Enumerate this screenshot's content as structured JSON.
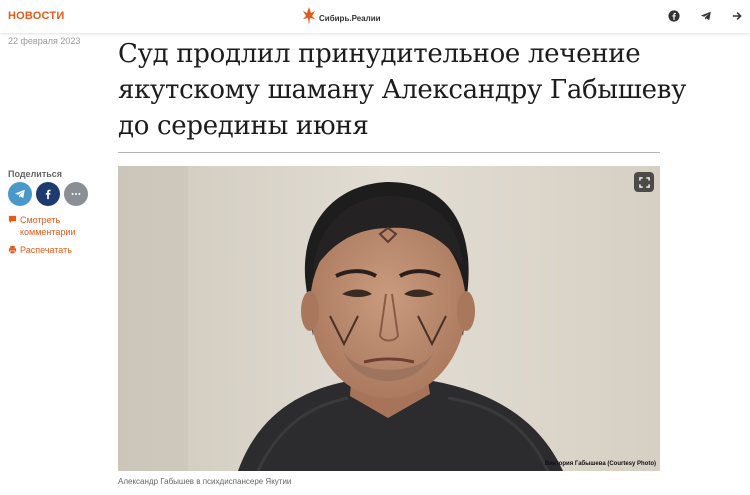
{
  "header": {
    "nav_label": "НОВОСТИ",
    "logo_text": "Сибирь.Реалии",
    "brand_color": "#e35a1c",
    "social_icons": [
      "facebook-icon",
      "telegram-icon",
      "share-icon"
    ]
  },
  "article": {
    "date": "22 февраля 2023",
    "title_lines": [
      "Суд продлил принудительное лечение",
      "якутскому шаману Александру Габышеву",
      "до середины июня"
    ]
  },
  "sidebar": {
    "share_label": "Поделиться",
    "share_buttons": [
      "telegram-icon",
      "facebook-icon",
      "more-icon"
    ],
    "comments_line1": "Смотреть",
    "comments_line2": "комментарии",
    "print_label": "Распечатать"
  },
  "photo": {
    "credit": "Виктория Габышева (Courtesy Photo)",
    "caption": "Александр Габышев в психдиспансере Якутии"
  }
}
